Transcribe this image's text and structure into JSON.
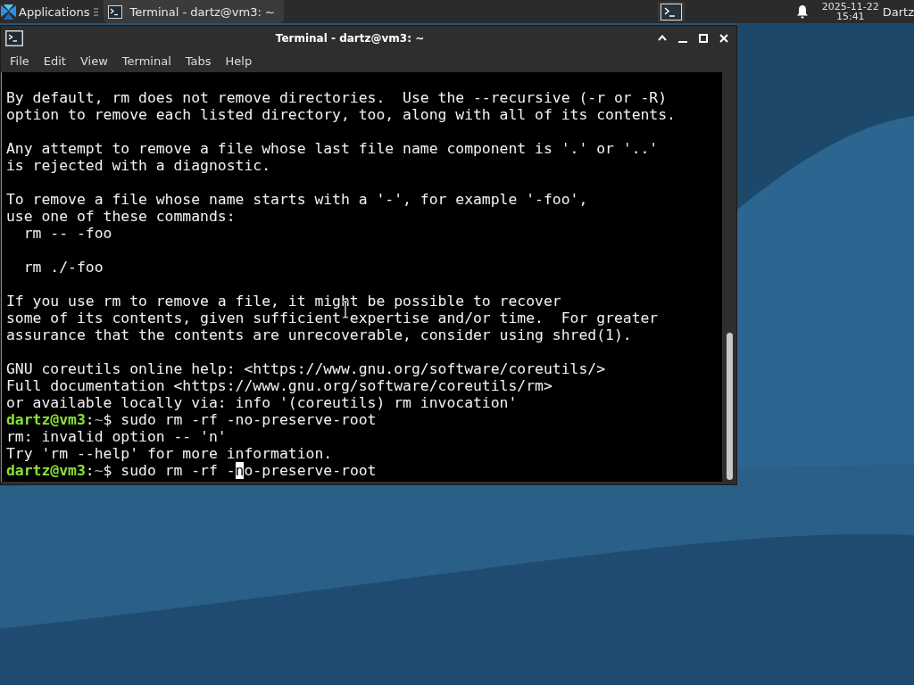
{
  "top_panel": {
    "applications_menu": {
      "label": "Applications"
    },
    "tasks": [
      {
        "label": "Terminal - dartz@vm3: ~",
        "selected": true
      }
    ],
    "clock": {
      "date": "2025-11-22",
      "time": "15:41"
    },
    "user": "Dartz"
  },
  "window": {
    "title": "Terminal - dartz@vm3: ~",
    "menu": [
      "File",
      "Edit",
      "View",
      "Terminal",
      "Tabs",
      "Help"
    ],
    "terminal": {
      "lines": [
        {
          "kind": "text",
          "text": "By default, rm does not remove directories.  Use the --recursive (-r or -R)"
        },
        {
          "kind": "text",
          "text": "option to remove each listed directory, too, along with all of its contents."
        },
        {
          "kind": "blank"
        },
        {
          "kind": "text",
          "text": "Any attempt to remove a file whose last file name component is '.' or '..'"
        },
        {
          "kind": "text",
          "text": "is rejected with a diagnostic."
        },
        {
          "kind": "blank"
        },
        {
          "kind": "text",
          "text": "To remove a file whose name starts with a '-', for example '-foo',"
        },
        {
          "kind": "text",
          "text": "use one of these commands:"
        },
        {
          "kind": "text",
          "text": "  rm -- -foo"
        },
        {
          "kind": "blank"
        },
        {
          "kind": "text",
          "text": "  rm ./-foo"
        },
        {
          "kind": "blank"
        },
        {
          "kind": "text",
          "text": "If you use rm to remove a file, it might be possible to recover"
        },
        {
          "kind": "text",
          "text": "some of its contents, given sufficient expertise and/or time.  For greater"
        },
        {
          "kind": "text",
          "text": "assurance that the contents are unrecoverable, consider using shred(1)."
        },
        {
          "kind": "blank"
        },
        {
          "kind": "text",
          "text": "GNU coreutils online help: <https://www.gnu.org/software/coreutils/>"
        },
        {
          "kind": "text",
          "text": "Full documentation <https://www.gnu.org/software/coreutils/rm>"
        },
        {
          "kind": "text",
          "text": "or available locally via: info '(coreutils) rm invocation'"
        },
        {
          "kind": "prompt",
          "user_host": "dartz@vm3",
          "separator": ":",
          "path": "~",
          "symbol": "$",
          "command": "sudo rm -rf -no-preserve-root"
        },
        {
          "kind": "text",
          "text": "rm: invalid option -- 'n'"
        },
        {
          "kind": "text",
          "text": "Try 'rm --help' for more information."
        },
        {
          "kind": "prompt",
          "user_host": "dartz@vm3",
          "separator": ":",
          "path": "~",
          "symbol": "$",
          "command": "sudo rm -rf -",
          "cursor_char": "n",
          "command_rest": "o-preserve-root"
        }
      ]
    }
  }
}
